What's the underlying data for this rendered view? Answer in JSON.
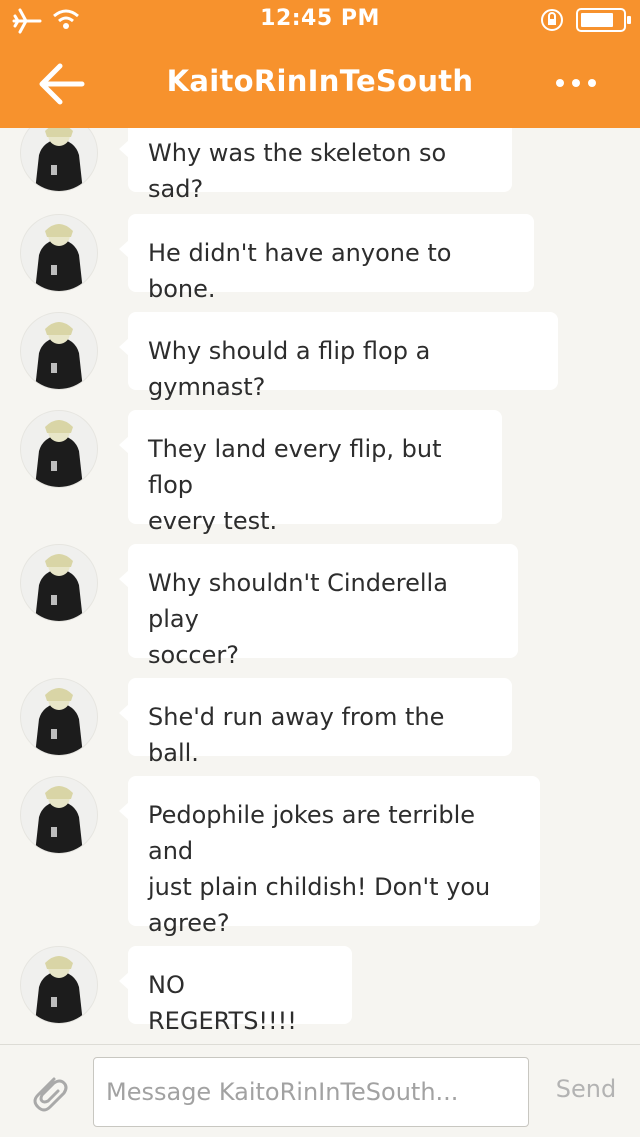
{
  "status_bar": {
    "time": "12:45 PM",
    "icons": [
      "airplane-icon",
      "wifi-icon",
      "orientation-lock-icon",
      "battery-icon"
    ]
  },
  "header": {
    "title": "KaitoRinInTeSouth",
    "back_icon": "arrow-left-icon",
    "more_icon": "more-dots-icon"
  },
  "colors": {
    "header_bg": "#f7922d",
    "chat_bg": "#f6f5f1",
    "bubble_bg": "#ffffff",
    "text": "#2d2d2d"
  },
  "messages": [
    {
      "text": "Why was the skeleton so sad?"
    },
    {
      "text": "He didn't have anyone to bone."
    },
    {
      "text": "Why should a flip flop a gymnast?"
    },
    {
      "text": "They land every flip, but flop\nevery test."
    },
    {
      "text": "Why shouldn't Cinderella play\nsoccer?"
    },
    {
      "text": "She'd run away from the ball."
    },
    {
      "text": "Pedophile jokes are terrible and\njust plain childish! Don't you\nagree?"
    },
    {
      "text": "NO REGERTS!!!!"
    }
  ],
  "composer": {
    "placeholder": "Message KaitoRinInTeSouth...",
    "value": "",
    "send_label": "Send",
    "attach_icon": "paperclip-icon"
  }
}
